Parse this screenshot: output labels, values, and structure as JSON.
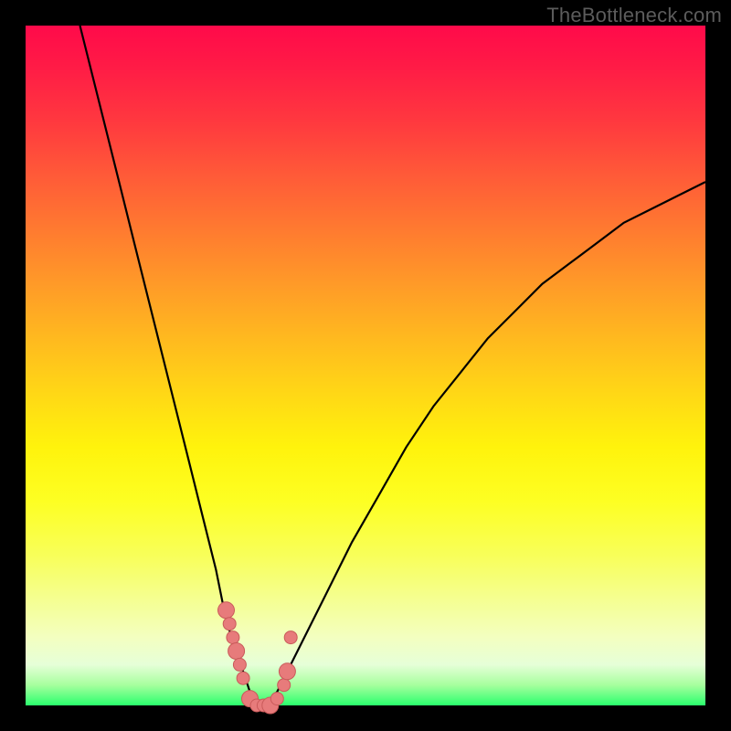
{
  "watermark": "TheBottleneck.com",
  "colors": {
    "frame": "#000000",
    "curve": "#000000",
    "dot_fill": "#e77b7b",
    "dot_stroke": "#c95a5a",
    "gradient_stops": [
      "#ff0a4a",
      "#ff9a28",
      "#fff30c",
      "#f3ffc0",
      "#2aff6d"
    ]
  },
  "chart_data": {
    "type": "line",
    "title": "",
    "xlabel": "",
    "ylabel": "",
    "xlim": [
      0,
      100
    ],
    "ylim": [
      0,
      100
    ],
    "grid": false,
    "legend": false,
    "series": [
      {
        "name": "bottleneck-curve",
        "note": "V-shaped curve; y is bottleneck percentage (0 at minimum near x≈34). Values estimated from pixel positions.",
        "x": [
          8,
          10,
          12,
          14,
          16,
          18,
          20,
          22,
          24,
          26,
          28,
          29,
          30,
          31,
          32,
          33,
          34,
          35,
          36,
          37,
          38,
          40,
          44,
          48,
          52,
          56,
          60,
          64,
          68,
          72,
          76,
          80,
          84,
          88,
          92,
          96,
          100
        ],
        "y": [
          100,
          92,
          84,
          76,
          68,
          60,
          52,
          44,
          36,
          28,
          20,
          15,
          11,
          8,
          5,
          2,
          0,
          0,
          1,
          2,
          4,
          8,
          16,
          24,
          31,
          38,
          44,
          49,
          54,
          58,
          62,
          65,
          68,
          71,
          73,
          75,
          77
        ]
      }
    ],
    "markers": {
      "name": "highlight-dots",
      "note": "Pink dots along the curve near the minimum region.",
      "x": [
        29.5,
        30,
        30.5,
        31,
        31.5,
        32,
        33,
        34,
        35,
        36,
        37,
        38,
        38.5,
        39
      ],
      "y": [
        14,
        12,
        10,
        8,
        6,
        4,
        1,
        0,
        0,
        0,
        1,
        3,
        5,
        10
      ]
    }
  }
}
